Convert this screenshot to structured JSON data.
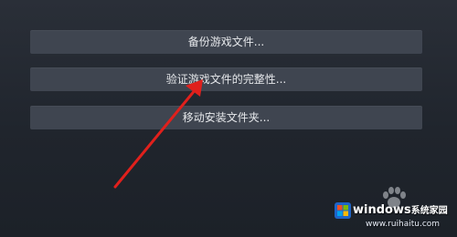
{
  "menu": {
    "backup_label": "备份游戏文件...",
    "verify_label": "验证游戏文件的完整性...",
    "move_label": "移动安装文件夹..."
  },
  "annotation": {
    "arrow_color": "#e0201c"
  },
  "watermark": {
    "brand": "windows",
    "suffix": "系统家园",
    "url": "www.ruihaitu.com",
    "logo_icon": "windows-logo-icon",
    "paw_icon": "paw-icon"
  },
  "colors": {
    "background": "#22272f",
    "button": "#3f4550",
    "button_text": "#e6e8eb"
  }
}
